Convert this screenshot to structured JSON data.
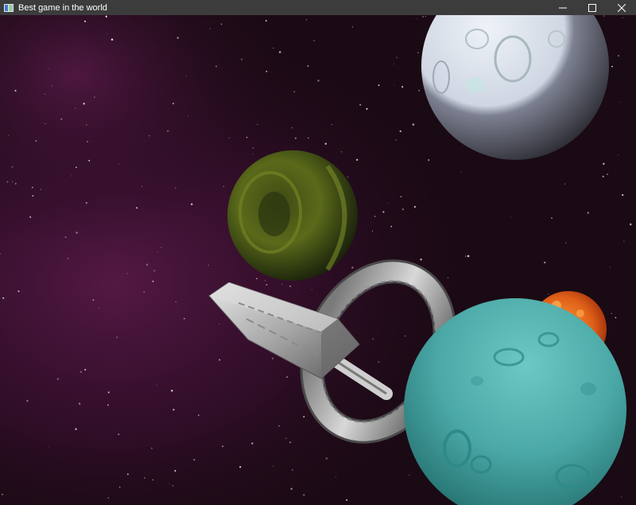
{
  "window": {
    "title": "Best game in the world",
    "title_color": "#ffffff",
    "titlebar_color": "#3c3c3c"
  },
  "controls": {
    "icons": [
      "app-icon",
      "minimize-icon",
      "maximize-icon",
      "close-icon"
    ]
  },
  "scene": {
    "background_colors": [
      "#1a0a14",
      "#5a1a4a",
      "#2a0a22"
    ],
    "objects": [
      {
        "name": "white-moon",
        "color": "#d8dfe8"
      },
      {
        "name": "green-planet",
        "color": "#5a6a1a"
      },
      {
        "name": "teal-planet",
        "color": "#4aa8a6"
      },
      {
        "name": "orange-sun",
        "color": "#e06018"
      },
      {
        "name": "spaceship",
        "color": "#b8b8b8"
      }
    ]
  }
}
